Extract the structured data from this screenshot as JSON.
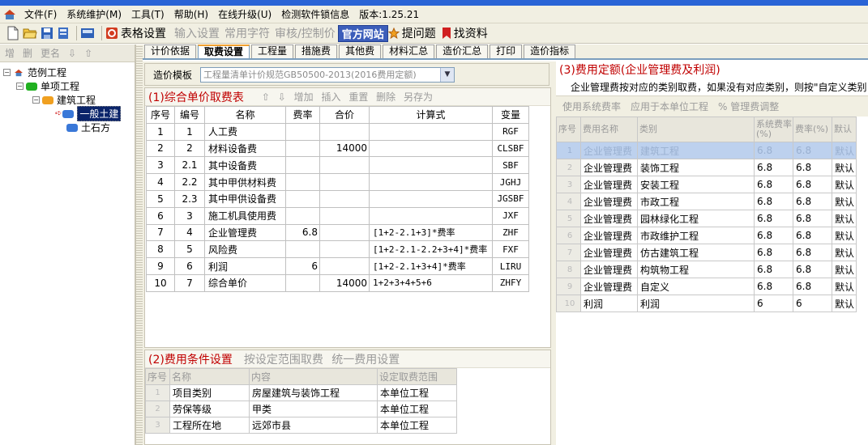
{
  "menu": {
    "items": [
      "文件(F)",
      "系统维护(M)",
      "工具(T)",
      "帮助(H)",
      "在线升级(U)",
      "检测软件锁信息"
    ],
    "version": "版本:1.25.21"
  },
  "toolbar": {
    "table_settings": "表格设置",
    "input_settings": "输入设置",
    "common_chars": "常用字符",
    "audit_control": "审核/控制价",
    "official_site": "官方网站",
    "ask_question": "提问题",
    "find_docs": "找资料"
  },
  "left_tools": [
    "增",
    "删",
    "更名",
    "⇩",
    "⇧"
  ],
  "tree": {
    "root": "范例工程",
    "unit": "单项工程",
    "building": "建筑工程",
    "selected": "一般土建",
    "earthwork": "土石方"
  },
  "tabs": [
    "计价依据",
    "取费设置",
    "工程量",
    "措施费",
    "其他费",
    "材料汇总",
    "造价汇总",
    "打印",
    "造价指标"
  ],
  "active_tab": "取费设置",
  "template": {
    "label": "造价模板",
    "value": "工程量清单计价规范GB50500-2013(2016费用定额)"
  },
  "section1": {
    "title": "(1)综合单价取费表",
    "actions": [
      "⇧",
      "⇩",
      "增加",
      "插入",
      "重置",
      "删除",
      "另存为"
    ],
    "columns": [
      "序号",
      "编号",
      "名称",
      "费率",
      "合价",
      "计算式",
      "变量"
    ],
    "rows": [
      [
        "1",
        "1",
        "人工费",
        "",
        "",
        "",
        "RGF"
      ],
      [
        "2",
        "2",
        "材料设备费",
        "",
        "14000",
        "",
        "CLSBF"
      ],
      [
        "3",
        "2.1",
        "其中设备费",
        "",
        "",
        "",
        "SBF"
      ],
      [
        "4",
        "2.2",
        "其中甲供材料费",
        "",
        "",
        "",
        "JGHJ"
      ],
      [
        "5",
        "2.3",
        "其中甲供设备费",
        "",
        "",
        "",
        "JGSBF"
      ],
      [
        "6",
        "3",
        "施工机具使用费",
        "",
        "",
        "",
        "JXF"
      ],
      [
        "7",
        "4",
        "企业管理费",
        "6.8",
        "",
        "[1+2-2.1+3]*费率",
        "ZHF"
      ],
      [
        "8",
        "5",
        "风险费",
        "",
        "",
        "[1+2-2.1-2.2+3+4]*费率",
        "FXF"
      ],
      [
        "9",
        "6",
        "利润",
        "6",
        "",
        "[1+2-2.1+3+4]*费率",
        "LIRU"
      ],
      [
        "10",
        "7",
        "综合单价",
        "",
        "14000",
        "1+2+3+4+5+6",
        "ZHFY"
      ]
    ]
  },
  "section2": {
    "title": "(2)费用条件设置",
    "actions": [
      "按设定范围取费",
      "统一费用设置"
    ],
    "columns": [
      "序号",
      "名称",
      "内容",
      "设定取费范围"
    ],
    "rows": [
      [
        "1",
        "项目类别",
        "房屋建筑与装饰工程",
        "本单位工程"
      ],
      [
        "2",
        "劳保等级",
        "甲类",
        "本单位工程"
      ],
      [
        "3",
        "工程所在地",
        "远郊市县",
        "本单位工程"
      ]
    ]
  },
  "section3": {
    "title": "(3)费用定额(企业管理费及利润)",
    "description": "企业管理费按对应的类别取费，如果没有对应类别，则按\"自定义类别",
    "actions": [
      "使用系统费率",
      "应用于本单位工程",
      "% 管理费调整"
    ],
    "columns": [
      "序号",
      "费用名称",
      "类别",
      "系统费率(%)",
      "费率(%)",
      "默认"
    ],
    "rows": [
      [
        "1",
        "企业管理费",
        "建筑工程",
        "6.8",
        "6.8",
        "默认"
      ],
      [
        "2",
        "企业管理费",
        "装饰工程",
        "6.8",
        "6.8",
        "默认"
      ],
      [
        "3",
        "企业管理费",
        "安装工程",
        "6.8",
        "6.8",
        "默认"
      ],
      [
        "4",
        "企业管理费",
        "市政工程",
        "6.8",
        "6.8",
        "默认"
      ],
      [
        "5",
        "企业管理费",
        "园林绿化工程",
        "6.8",
        "6.8",
        "默认"
      ],
      [
        "6",
        "企业管理费",
        "市政维护工程",
        "6.8",
        "6.8",
        "默认"
      ],
      [
        "7",
        "企业管理费",
        "仿古建筑工程",
        "6.8",
        "6.8",
        "默认"
      ],
      [
        "8",
        "企业管理费",
        "构筑物工程",
        "6.8",
        "6.8",
        "默认"
      ],
      [
        "9",
        "企业管理费",
        "自定义",
        "6.8",
        "6.8",
        "默认"
      ],
      [
        "10",
        "利润",
        "利润",
        "6",
        "6",
        "默认"
      ]
    ]
  }
}
